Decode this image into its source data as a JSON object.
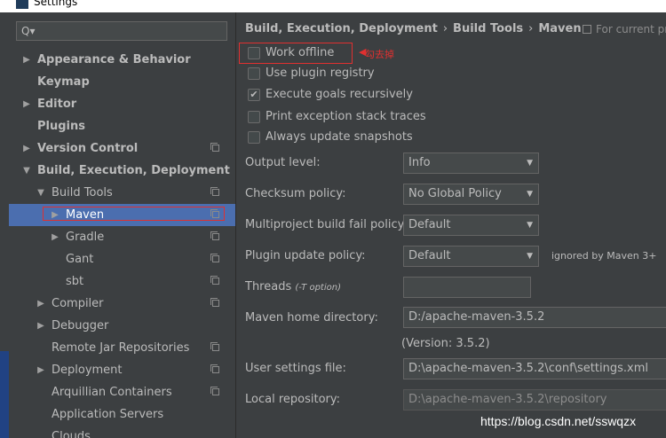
{
  "window": {
    "title": "Settings"
  },
  "sidebar": {
    "search": {
      "placeholder": ""
    },
    "items": [
      {
        "label": "Appearance & Behavior",
        "bold": true,
        "arrow": "right",
        "indent": 0,
        "copy": false,
        "selected": false
      },
      {
        "label": "Keymap",
        "bold": true,
        "arrow": "",
        "indent": 0,
        "copy": false,
        "selected": false
      },
      {
        "label": "Editor",
        "bold": true,
        "arrow": "right",
        "indent": 0,
        "copy": false,
        "selected": false
      },
      {
        "label": "Plugins",
        "bold": true,
        "arrow": "",
        "indent": 0,
        "copy": false,
        "selected": false
      },
      {
        "label": "Version Control",
        "bold": true,
        "arrow": "right",
        "indent": 0,
        "copy": true,
        "selected": false
      },
      {
        "label": "Build, Execution, Deployment",
        "bold": true,
        "arrow": "down",
        "indent": 0,
        "copy": false,
        "selected": false
      },
      {
        "label": "Build Tools",
        "bold": false,
        "arrow": "down",
        "indent": 1,
        "copy": true,
        "selected": false
      },
      {
        "label": "Maven",
        "bold": false,
        "arrow": "right",
        "indent": 2,
        "copy": true,
        "selected": true
      },
      {
        "label": "Gradle",
        "bold": false,
        "arrow": "right",
        "indent": 2,
        "copy": true,
        "selected": false
      },
      {
        "label": "Gant",
        "bold": false,
        "arrow": "",
        "indent": 2,
        "copy": true,
        "selected": false
      },
      {
        "label": "sbt",
        "bold": false,
        "arrow": "",
        "indent": 2,
        "copy": true,
        "selected": false
      },
      {
        "label": "Compiler",
        "bold": false,
        "arrow": "right",
        "indent": 1,
        "copy": true,
        "selected": false
      },
      {
        "label": "Debugger",
        "bold": false,
        "arrow": "right",
        "indent": 1,
        "copy": false,
        "selected": false
      },
      {
        "label": "Remote Jar Repositories",
        "bold": false,
        "arrow": "",
        "indent": 1,
        "copy": true,
        "selected": false
      },
      {
        "label": "Deployment",
        "bold": false,
        "arrow": "right",
        "indent": 1,
        "copy": true,
        "selected": false
      },
      {
        "label": "Arquillian Containers",
        "bold": false,
        "arrow": "",
        "indent": 1,
        "copy": true,
        "selected": false
      },
      {
        "label": "Application Servers",
        "bold": false,
        "arrow": "",
        "indent": 1,
        "copy": false,
        "selected": false
      },
      {
        "label": "Clouds",
        "bold": false,
        "arrow": "",
        "indent": 1,
        "copy": false,
        "selected": false
      }
    ]
  },
  "breadcrumb": {
    "items": [
      "Build, Execution, Deployment",
      "Build Tools",
      "Maven"
    ],
    "separator": "›",
    "for_current": "For current project"
  },
  "checkboxes": [
    {
      "label": "Work offline",
      "checked": false
    },
    {
      "label": "Use plugin registry",
      "checked": false
    },
    {
      "label": "Execute goals recursively",
      "checked": true
    },
    {
      "label": "Print exception stack traces",
      "checked": false
    },
    {
      "label": "Always update snapshots",
      "checked": false
    }
  ],
  "annotation": {
    "text": "勾去掉"
  },
  "form": {
    "output_level": {
      "label": "Output level:",
      "value": "Info"
    },
    "checksum": {
      "label": "Checksum policy:",
      "value": "No Global Policy"
    },
    "multiproject": {
      "label": "Multiproject build fail policy:",
      "value": "Default"
    },
    "plugin_update": {
      "label": "Plugin update policy:",
      "value": "Default",
      "hint": "ignored by Maven 3+"
    },
    "threads": {
      "label": "Threads",
      "option": "(-T option)",
      "value": ""
    },
    "maven_home": {
      "label": "Maven home directory:",
      "value": "D:/apache-maven-3.5.2",
      "version": "(Version: 3.5.2)"
    },
    "user_settings": {
      "label": "User settings file:",
      "value": "D:\\apache-maven-3.5.2\\conf\\settings.xml"
    },
    "local_repo": {
      "label": "Local repository:",
      "value": "D:\\apache-maven-3.5.2\\repository"
    }
  },
  "watermark": "https://blog.csdn.net/sswqzx",
  "colors": {
    "background": "#3c3f41",
    "selection": "#4b6eaf",
    "annotation": "#e03030"
  }
}
